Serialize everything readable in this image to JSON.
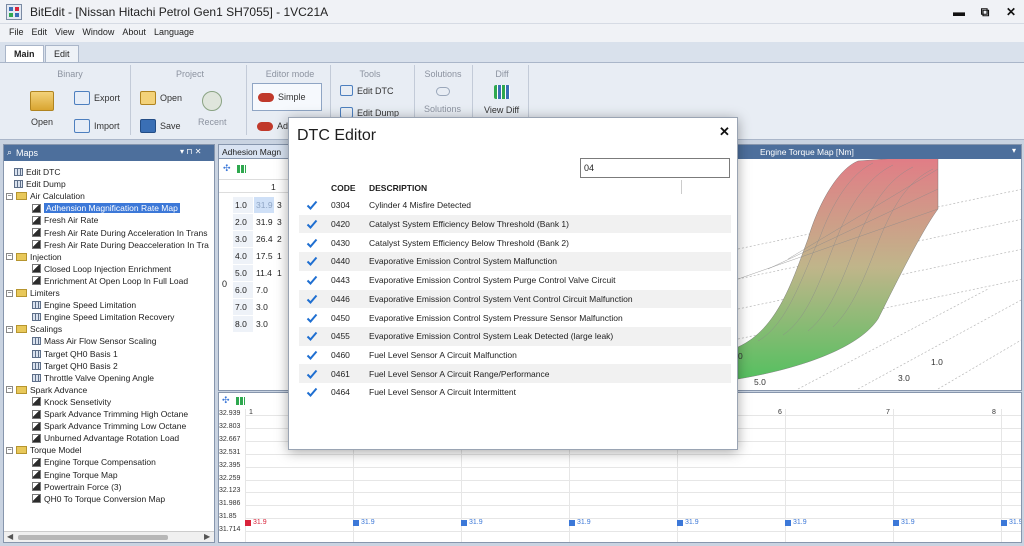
{
  "window": {
    "title": "BitEdit - [Nissan Hitachi Petrol Gen1 SH7055] - 1VC21A",
    "minimize": "▬",
    "restore": "⧉",
    "close": "✕"
  },
  "menu": [
    "File",
    "Edit",
    "View",
    "Window",
    "About",
    "Language"
  ],
  "ribbon_tabs": [
    {
      "label": "Main",
      "active": true
    },
    {
      "label": "Edit",
      "active": false
    }
  ],
  "ribbon": {
    "groups": {
      "binary": "Binary",
      "project": "Project",
      "editor_mode": "Editor mode",
      "tools": "Tools",
      "solutions": "Solutions",
      "diff": "Diff"
    },
    "buttons": {
      "open": "Open",
      "export": "Export",
      "import": "Import",
      "project_open": "Open",
      "save": "Save",
      "recent": "Recent",
      "simple": "Simple",
      "advanced": "Ad",
      "edit_dtc": "Edit DTC",
      "edit_dump": "Edit Dump",
      "solutions": "Solutions",
      "view_diff": "View Diff"
    }
  },
  "maps_panel": {
    "title": "Maps",
    "pin": "▾ ⊓ ✕",
    "tree": [
      {
        "label": "Edit DTC",
        "type": "tool",
        "level": 0
      },
      {
        "label": "Edit Dump",
        "type": "tool",
        "level": 0
      },
      {
        "label": "Air Calculation",
        "type": "folder",
        "level": 0
      },
      {
        "label": "Adhension Magnification Rate Map",
        "type": "map",
        "level": 1,
        "selected": true
      },
      {
        "label": "Fresh Air Rate",
        "type": "map",
        "level": 1
      },
      {
        "label": "Fresh Air Rate During Acceleration In Trans",
        "type": "map",
        "level": 1
      },
      {
        "label": "Fresh Air Rate During Deacceleration In Tra",
        "type": "map",
        "level": 1
      },
      {
        "label": "Injection",
        "type": "folder",
        "level": 0
      },
      {
        "label": "Closed Loop Injection Enrichment",
        "type": "map",
        "level": 1
      },
      {
        "label": "Enrichment At Open Loop In Full Load",
        "type": "map",
        "level": 1
      },
      {
        "label": "Limiters",
        "type": "folder",
        "level": 0
      },
      {
        "label": "Engine Speed Limitation",
        "type": "scalar",
        "level": 1
      },
      {
        "label": "Engine Speed Limitation Recovery",
        "type": "scalar",
        "level": 1
      },
      {
        "label": "Scalings",
        "type": "folder",
        "level": 0
      },
      {
        "label": "Mass Air Flow Sensor Scaling",
        "type": "table",
        "level": 1
      },
      {
        "label": "Target QH0 Basis 1",
        "type": "table",
        "level": 1
      },
      {
        "label": "Target QH0 Basis 2",
        "type": "table",
        "level": 1
      },
      {
        "label": "Throttle Valve Opening Angle",
        "type": "table",
        "level": 1
      },
      {
        "label": "Spark Advance",
        "type": "folder",
        "level": 0
      },
      {
        "label": "Knock Sensetivity",
        "type": "map",
        "level": 1
      },
      {
        "label": "Spark Advance Trimming High Octane",
        "type": "map",
        "level": 1
      },
      {
        "label": "Spark Advance Trimming Low Octane",
        "type": "map",
        "level": 1
      },
      {
        "label": "Unburned Advantage Rotation Load",
        "type": "map",
        "level": 1
      },
      {
        "label": "Torque Model",
        "type": "folder",
        "level": 0
      },
      {
        "label": "Engine Torque Compensation",
        "type": "map",
        "level": 1
      },
      {
        "label": "Engine Torque Map",
        "type": "map",
        "level": 1
      },
      {
        "label": "Powertrain Force (3)",
        "type": "map",
        "level": 1
      },
      {
        "label": "QH0 To Torque Conversion Map",
        "type": "map",
        "level": 1
      }
    ]
  },
  "center_panel": {
    "tab": "Adhesion Magn",
    "col_header": "1",
    "axis_label": "0",
    "rows": [
      {
        "axis": "1.0",
        "value": "31.9"
      },
      {
        "axis": "2.0",
        "value": "31.9"
      },
      {
        "axis": "3.0",
        "value": "26.4"
      },
      {
        "axis": "4.0",
        "value": "17.5"
      },
      {
        "axis": "5.0",
        "value": "11.4"
      },
      {
        "axis": "6.0",
        "value": "7.0"
      },
      {
        "axis": "7.0",
        "value": "3.0"
      },
      {
        "axis": "8.0",
        "value": "3.0"
      }
    ],
    "partial_col": [
      "3",
      "3",
      "2",
      "1",
      "1",
      "",
      "",
      ""
    ]
  },
  "right_panel": {
    "tab": "Engine Torque Map [Nm]",
    "ticks": [
      "0",
      "1.0",
      "5.0",
      "3.0"
    ]
  },
  "graph_panel": {
    "y_labels": [
      "32.939",
      "32.803",
      "32.667",
      "32.531",
      "32.395",
      "32.259",
      "32.123",
      "31.986",
      "31.85",
      "31.714"
    ],
    "x_labels": [
      "1",
      "6",
      "7",
      "8"
    ],
    "points": [
      "31.9",
      "31.9",
      "31.9",
      "31.9",
      "31.9",
      "31.9",
      "31.9",
      "31.9"
    ]
  },
  "dtc_editor": {
    "title": "DTC Editor",
    "close": "✕",
    "filter_value": "04",
    "columns": {
      "code": "CODE",
      "description": "DESCRIPTION"
    },
    "rows": [
      {
        "code": "0304",
        "description": "Cylinder 4 Misfire Detected",
        "checked": true
      },
      {
        "code": "0420",
        "description": "Catalyst System Efficiency Below Threshold (Bank 1)",
        "checked": true
      },
      {
        "code": "0430",
        "description": "Catalyst System Efficiency Below Threshold (Bank 2)",
        "checked": true
      },
      {
        "code": "0440",
        "description": "Evaporative Emission Control System Malfunction",
        "checked": true
      },
      {
        "code": "0443",
        "description": "Evaporative Emission Control System Purge Control Valve Circuit",
        "checked": true
      },
      {
        "code": "0446",
        "description": "Evaporative Emission Control System Vent Control Circuit Malfunction",
        "checked": true
      },
      {
        "code": "0450",
        "description": "Evaporative Emission Control System Pressure Sensor Malfunction",
        "checked": true
      },
      {
        "code": "0455",
        "description": "Evaporative Emission Control System Leak Detected (large leak)",
        "checked": true
      },
      {
        "code": "0460",
        "description": "Fuel Level Sensor A Circuit Malfunction",
        "checked": true
      },
      {
        "code": "0461",
        "description": "Fuel Level Sensor A Circuit Range/Performance",
        "checked": true
      },
      {
        "code": "0464",
        "description": "Fuel Level Sensor A Circuit Intermittent",
        "checked": true
      }
    ]
  },
  "colors": {
    "accent": "#3c78d8",
    "panel_header": "#4d6f9c",
    "checkbox": "#1f6fd1"
  }
}
